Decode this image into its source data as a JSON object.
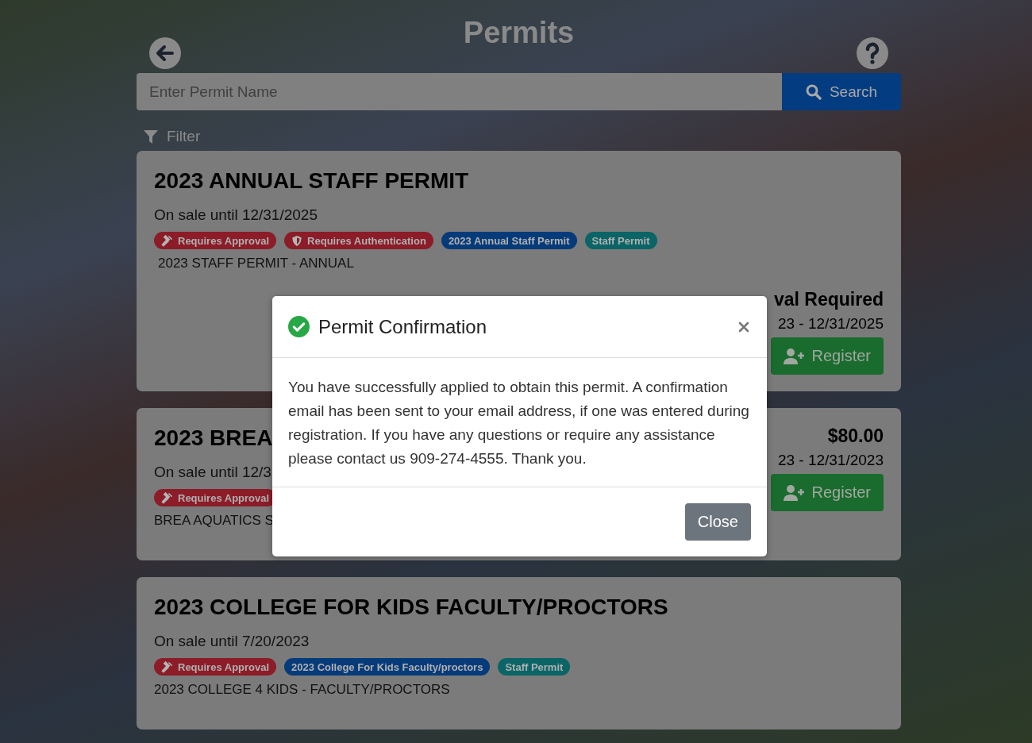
{
  "header": {
    "title": "Permits"
  },
  "search": {
    "placeholder": "Enter Permit Name",
    "button": "Search"
  },
  "filter": {
    "label": "Filter"
  },
  "permits": [
    {
      "title": "2023 ANNUAL STAFF PERMIT",
      "sale": "On sale until 12/31/2025",
      "tags": [
        {
          "label": "Requires Approval",
          "kind": "approval",
          "color": "#8b1c28"
        },
        {
          "label": "Requires Authentication",
          "kind": "auth",
          "color": "#8b1c28"
        },
        {
          "label": "2023 Annual Staff Permit",
          "kind": "plain",
          "color": "#063b7a"
        },
        {
          "label": "Staff Permit",
          "kind": "plain",
          "color": "#0b6466"
        }
      ],
      "description": "2023 STAFF PERMIT - ANNUAL",
      "price": "val Required",
      "dates": "23 - 12/31/2025",
      "register": "Register"
    },
    {
      "title": "2023 BREA",
      "sale": "On sale until 12/3",
      "tags": [
        {
          "label": "Requires Approval",
          "kind": "approval",
          "color": "#8b1c28"
        }
      ],
      "description": "BREA AQUATICS S",
      "price": "$80.00",
      "dates": "23 - 12/31/2023",
      "register": "Register"
    },
    {
      "title": "2023 COLLEGE FOR KIDS FACULTY/PROCTORS",
      "sale": "On sale until 7/20/2023",
      "tags": [
        {
          "label": "Requires Approval",
          "kind": "approval",
          "color": "#8b1c28"
        },
        {
          "label": "2023 College For Kids Faculty/proctors",
          "kind": "plain",
          "color": "#063b7a"
        },
        {
          "label": "Staff Permit",
          "kind": "plain",
          "color": "#0b6466"
        }
      ],
      "description": "2023 COLLEGE 4 KIDS - FACULTY/PROCTORS"
    }
  ],
  "modal": {
    "title": "Permit Confirmation",
    "body": "You have successfully applied to obtain this permit. A confirmation email has been sent to your email address, if one was entered during registration. If you have any questions or require any assistance please contact us 909-274-4555. Thank you.",
    "close_button": "Close"
  }
}
